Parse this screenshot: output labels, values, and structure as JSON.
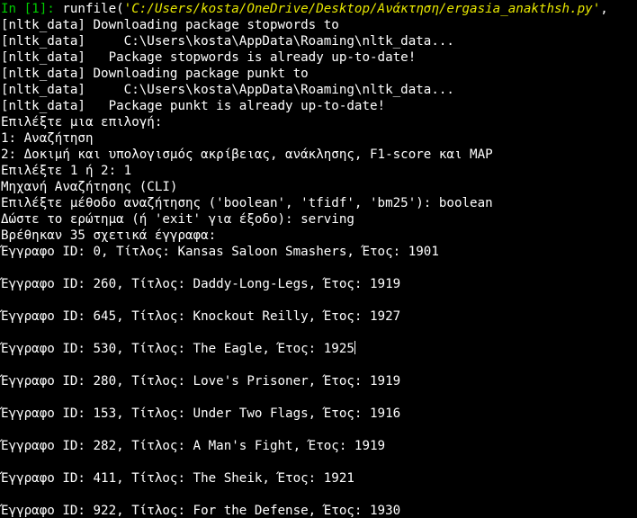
{
  "prompt": {
    "in_label": "In [1]:",
    "command": " runfile(",
    "path": "'C:/Users/kosta/OneDrive/Desktop/Ανάκτηση/ergasia_anakthsh.py'",
    "tail": ","
  },
  "output_lines": [
    "[nltk_data] Downloading package stopwords to",
    "[nltk_data]     C:\\Users\\kosta\\AppData\\Roaming\\nltk_data...",
    "[nltk_data]   Package stopwords is already up-to-date!",
    "[nltk_data] Downloading package punkt to",
    "[nltk_data]     C:\\Users\\kosta\\AppData\\Roaming\\nltk_data...",
    "[nltk_data]   Package punkt is already up-to-date!",
    "Επιλέξτε μια επιλογή:",
    "1: Αναζήτηση",
    "2: Δοκιμή και υπολογισμός ακρίβειας, ανάκλησης, F1-score και MAP",
    "Επιλέξτε 1 ή 2: 1",
    "Μηχανή Αναζήτησης (CLI)",
    "Επιλέξτε μέθοδο αναζήτησης ('boolean', 'tfidf', 'bm25'): boolean",
    "Δώστε το ερώτημα (ή 'exit' για έξοδο): serving",
    "Βρέθηκαν 35 σχετικά έγγραφα:",
    "Έγγραφο ID: 0, Τίτλος: Kansas Saloon Smashers, Έτος: 1901"
  ],
  "results": [
    "Έγγραφο ID: 260, Τίτλος: Daddy-Long-Legs, Έτος: 1919",
    "Έγγραφο ID: 645, Τίτλος: Knockout Reilly, Έτος: 1927",
    "Έγγραφο ID: 530, Τίτλος: The Eagle, Έτος: 1925",
    "Έγγραφο ID: 280, Τίτλος: Love's Prisoner, Έτος: 1919",
    "Έγγραφο ID: 153, Τίτλος: Under Two Flags, Έτος: 1916",
    "Έγγραφο ID: 282, Τίτλος: A Man's Fight, Έτος: 1919",
    "Έγγραφο ID: 411, Τίτλος: The Sheik, Έτος: 1921",
    "Έγγραφο ID: 922, Τίτλος: For the Defense, Έτος: 1930"
  ],
  "colors": {
    "background": "#000000",
    "text": "#ffffff",
    "prompt_green": "#00cc00",
    "path_yellow": "#e6e600"
  }
}
